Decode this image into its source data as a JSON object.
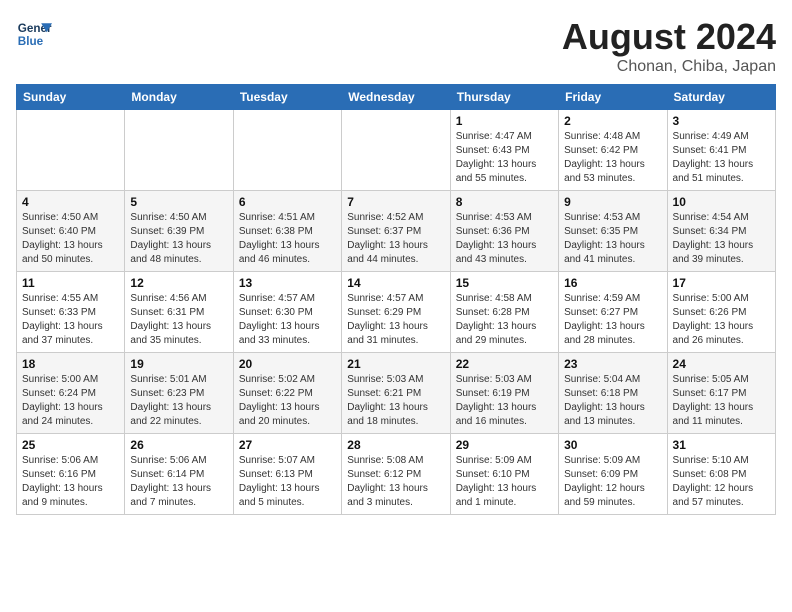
{
  "header": {
    "logo_line1": "General",
    "logo_line2": "Blue",
    "month_year": "August 2024",
    "location": "Chonan, Chiba, Japan"
  },
  "weekdays": [
    "Sunday",
    "Monday",
    "Tuesday",
    "Wednesday",
    "Thursday",
    "Friday",
    "Saturday"
  ],
  "weeks": [
    [
      {
        "day": "",
        "info": ""
      },
      {
        "day": "",
        "info": ""
      },
      {
        "day": "",
        "info": ""
      },
      {
        "day": "",
        "info": ""
      },
      {
        "day": "1",
        "info": "Sunrise: 4:47 AM\nSunset: 6:43 PM\nDaylight: 13 hours\nand 55 minutes."
      },
      {
        "day": "2",
        "info": "Sunrise: 4:48 AM\nSunset: 6:42 PM\nDaylight: 13 hours\nand 53 minutes."
      },
      {
        "day": "3",
        "info": "Sunrise: 4:49 AM\nSunset: 6:41 PM\nDaylight: 13 hours\nand 51 minutes."
      }
    ],
    [
      {
        "day": "4",
        "info": "Sunrise: 4:50 AM\nSunset: 6:40 PM\nDaylight: 13 hours\nand 50 minutes."
      },
      {
        "day": "5",
        "info": "Sunrise: 4:50 AM\nSunset: 6:39 PM\nDaylight: 13 hours\nand 48 minutes."
      },
      {
        "day": "6",
        "info": "Sunrise: 4:51 AM\nSunset: 6:38 PM\nDaylight: 13 hours\nand 46 minutes."
      },
      {
        "day": "7",
        "info": "Sunrise: 4:52 AM\nSunset: 6:37 PM\nDaylight: 13 hours\nand 44 minutes."
      },
      {
        "day": "8",
        "info": "Sunrise: 4:53 AM\nSunset: 6:36 PM\nDaylight: 13 hours\nand 43 minutes."
      },
      {
        "day": "9",
        "info": "Sunrise: 4:53 AM\nSunset: 6:35 PM\nDaylight: 13 hours\nand 41 minutes."
      },
      {
        "day": "10",
        "info": "Sunrise: 4:54 AM\nSunset: 6:34 PM\nDaylight: 13 hours\nand 39 minutes."
      }
    ],
    [
      {
        "day": "11",
        "info": "Sunrise: 4:55 AM\nSunset: 6:33 PM\nDaylight: 13 hours\nand 37 minutes."
      },
      {
        "day": "12",
        "info": "Sunrise: 4:56 AM\nSunset: 6:31 PM\nDaylight: 13 hours\nand 35 minutes."
      },
      {
        "day": "13",
        "info": "Sunrise: 4:57 AM\nSunset: 6:30 PM\nDaylight: 13 hours\nand 33 minutes."
      },
      {
        "day": "14",
        "info": "Sunrise: 4:57 AM\nSunset: 6:29 PM\nDaylight: 13 hours\nand 31 minutes."
      },
      {
        "day": "15",
        "info": "Sunrise: 4:58 AM\nSunset: 6:28 PM\nDaylight: 13 hours\nand 29 minutes."
      },
      {
        "day": "16",
        "info": "Sunrise: 4:59 AM\nSunset: 6:27 PM\nDaylight: 13 hours\nand 28 minutes."
      },
      {
        "day": "17",
        "info": "Sunrise: 5:00 AM\nSunset: 6:26 PM\nDaylight: 13 hours\nand 26 minutes."
      }
    ],
    [
      {
        "day": "18",
        "info": "Sunrise: 5:00 AM\nSunset: 6:24 PM\nDaylight: 13 hours\nand 24 minutes."
      },
      {
        "day": "19",
        "info": "Sunrise: 5:01 AM\nSunset: 6:23 PM\nDaylight: 13 hours\nand 22 minutes."
      },
      {
        "day": "20",
        "info": "Sunrise: 5:02 AM\nSunset: 6:22 PM\nDaylight: 13 hours\nand 20 minutes."
      },
      {
        "day": "21",
        "info": "Sunrise: 5:03 AM\nSunset: 6:21 PM\nDaylight: 13 hours\nand 18 minutes."
      },
      {
        "day": "22",
        "info": "Sunrise: 5:03 AM\nSunset: 6:19 PM\nDaylight: 13 hours\nand 16 minutes."
      },
      {
        "day": "23",
        "info": "Sunrise: 5:04 AM\nSunset: 6:18 PM\nDaylight: 13 hours\nand 13 minutes."
      },
      {
        "day": "24",
        "info": "Sunrise: 5:05 AM\nSunset: 6:17 PM\nDaylight: 13 hours\nand 11 minutes."
      }
    ],
    [
      {
        "day": "25",
        "info": "Sunrise: 5:06 AM\nSunset: 6:16 PM\nDaylight: 13 hours\nand 9 minutes."
      },
      {
        "day": "26",
        "info": "Sunrise: 5:06 AM\nSunset: 6:14 PM\nDaylight: 13 hours\nand 7 minutes."
      },
      {
        "day": "27",
        "info": "Sunrise: 5:07 AM\nSunset: 6:13 PM\nDaylight: 13 hours\nand 5 minutes."
      },
      {
        "day": "28",
        "info": "Sunrise: 5:08 AM\nSunset: 6:12 PM\nDaylight: 13 hours\nand 3 minutes."
      },
      {
        "day": "29",
        "info": "Sunrise: 5:09 AM\nSunset: 6:10 PM\nDaylight: 13 hours\nand 1 minute."
      },
      {
        "day": "30",
        "info": "Sunrise: 5:09 AM\nSunset: 6:09 PM\nDaylight: 12 hours\nand 59 minutes."
      },
      {
        "day": "31",
        "info": "Sunrise: 5:10 AM\nSunset: 6:08 PM\nDaylight: 12 hours\nand 57 minutes."
      }
    ]
  ]
}
